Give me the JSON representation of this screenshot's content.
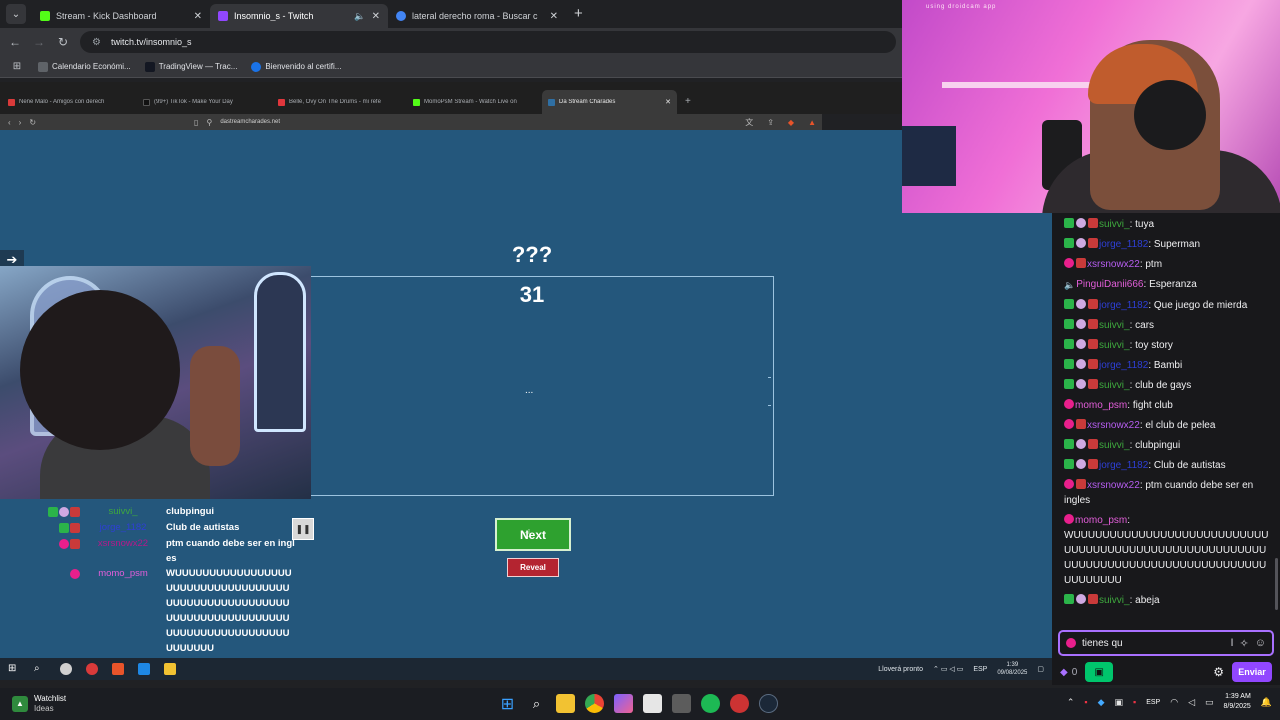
{
  "outer_browser": {
    "tabs": [
      {
        "label": "Stream - Kick Dashboard",
        "active": false,
        "color": "#53fc18"
      },
      {
        "label": "Insomnio_s - Twitch",
        "active": true,
        "color": "#9147ff"
      },
      {
        "label": "lateral derecho roma - Buscar c",
        "active": false,
        "color": "#4285f4"
      }
    ],
    "new_tab": "+",
    "url": "twitch.tv/insomnio_s",
    "bookmarks": [
      "Calendario Económi...",
      "TradingView — Trac...",
      "Bienvenido al certifi..."
    ]
  },
  "inner_browser": {
    "tabs": [
      {
        "label": "Nene Malo - Amigos con derech",
        "color": "#d93a3a"
      },
      {
        "label": "(99+) TikTok - Make Your Day",
        "color": "#111111"
      },
      {
        "label": "Bellé, Ovy On The Drums - mi refe",
        "color": "#e0363c"
      },
      {
        "label": "MomoPsM Stream - Watch Live on",
        "color": "#53fc18"
      },
      {
        "label": "Da Stream Charades",
        "color": "#2f6fa3"
      }
    ],
    "url": "dastreamcharades.net"
  },
  "charades": {
    "question": "???",
    "timer": "31",
    "word_placeholder": "...",
    "next_label": "Next",
    "reveal_label": "Reveal"
  },
  "overlay_chat": [
    {
      "user": "suivvi_",
      "color": "#3ea93e",
      "badges": [
        "green",
        "drop",
        "red"
      ],
      "message": "clubpingui"
    },
    {
      "user": "jorge_1182",
      "color": "#2e3fd6",
      "badges": [
        "green",
        "red"
      ],
      "message": "Club de autistas"
    },
    {
      "user": "xsrsnowx22",
      "color": "#b5198a",
      "badges": [
        "pink",
        "red"
      ],
      "message": "ptm cuando debe ser en ingles"
    },
    {
      "user": "momo_psm",
      "color": "#e25ed9",
      "badges": [
        "pink"
      ],
      "message": "WUUUUUUUUUUUUUUUUUUUUUUUUUUUUUUUUUUUUUUUUUUUUUUUUUUUUUUUUUUUUUUUUUUUUUUUUUUUUUUUUUUUUUUUUUUUUUUUU"
    }
  ],
  "twitch_chat": [
    {
      "user": "suivvi_",
      "color": "#3ea93e",
      "badges": [
        "green",
        "drop",
        "red"
      ],
      "message": "tuya"
    },
    {
      "user": "jorge_1182",
      "color": "#2e3fd6",
      "badges": [
        "green",
        "drop",
        "red"
      ],
      "message": "Superman"
    },
    {
      "user": "xsrsnowx22",
      "color": "#b65df0",
      "badges": [
        "pink",
        "red"
      ],
      "message": "ptm"
    },
    {
      "user": "PinguiDanii666",
      "color": "#e25ed9",
      "badges": [
        "mute"
      ],
      "message": "Esperanza"
    },
    {
      "user": "jorge_1182",
      "color": "#2e3fd6",
      "badges": [
        "green",
        "drop",
        "red"
      ],
      "message": "Que juego de mierda"
    },
    {
      "user": "suivvi_",
      "color": "#3ea93e",
      "badges": [
        "green",
        "drop",
        "red"
      ],
      "message": "cars"
    },
    {
      "user": "suivvi_",
      "color": "#3ea93e",
      "badges": [
        "green",
        "drop",
        "red"
      ],
      "message": "toy story"
    },
    {
      "user": "jorge_1182",
      "color": "#2e3fd6",
      "badges": [
        "green",
        "drop",
        "red"
      ],
      "message": "Bambi"
    },
    {
      "user": "suivvi_",
      "color": "#3ea93e",
      "badges": [
        "green",
        "drop",
        "red"
      ],
      "message": "club de gays"
    },
    {
      "user": "momo_psm",
      "color": "#e25ed9",
      "badges": [
        "pink"
      ],
      "message": "fight club"
    },
    {
      "user": "xsrsnowx22",
      "color": "#b65df0",
      "badges": [
        "pink",
        "red"
      ],
      "message": "el club de pelea"
    },
    {
      "user": "suivvi_",
      "color": "#3ea93e",
      "badges": [
        "green",
        "drop",
        "red"
      ],
      "message": "clubpingui"
    },
    {
      "user": "jorge_1182",
      "color": "#2e3fd6",
      "badges": [
        "green",
        "drop",
        "red"
      ],
      "message": "Club de autistas"
    },
    {
      "user": "xsrsnowx22",
      "color": "#b65df0",
      "badges": [
        "pink",
        "red"
      ],
      "message": "ptm cuando debe ser en ingles"
    },
    {
      "user": "momo_psm",
      "color": "#e25ed9",
      "badges": [
        "pink"
      ],
      "message": "WUUUUUUUUUUUUUUUUUUUUUUUUUUUUUUUUUUUUUUUUUUUUUUUUUUUUUUUUUUUUUUUUUUUUUUUUUUUUUUUUUUUUUUUUUUU"
    },
    {
      "user": "suivvi_",
      "color": "#3ea93e",
      "badges": [
        "green",
        "drop",
        "red"
      ],
      "message": "abeja"
    }
  ],
  "chat_input": {
    "value": "tienes qu"
  },
  "chat_footer": {
    "points": "0",
    "send_label": "Enviar"
  },
  "inner_taskbar": {
    "weather": "Lloverá pronto",
    "lang": "ESP",
    "time": "1:39",
    "date": "09/08/2025"
  },
  "webcam": {
    "watermark": "using droidcam app"
  },
  "taskbar": {
    "widget_title": "Watchlist",
    "widget_sub": "Ideas",
    "lang": "ESP",
    "time": "1:39 AM",
    "date": "8/9/2025"
  },
  "colors": {
    "page_bg": "#24577c",
    "next_green": "#2ea12f",
    "reveal_red": "#b42430",
    "twitch_purple": "#9147ff"
  }
}
